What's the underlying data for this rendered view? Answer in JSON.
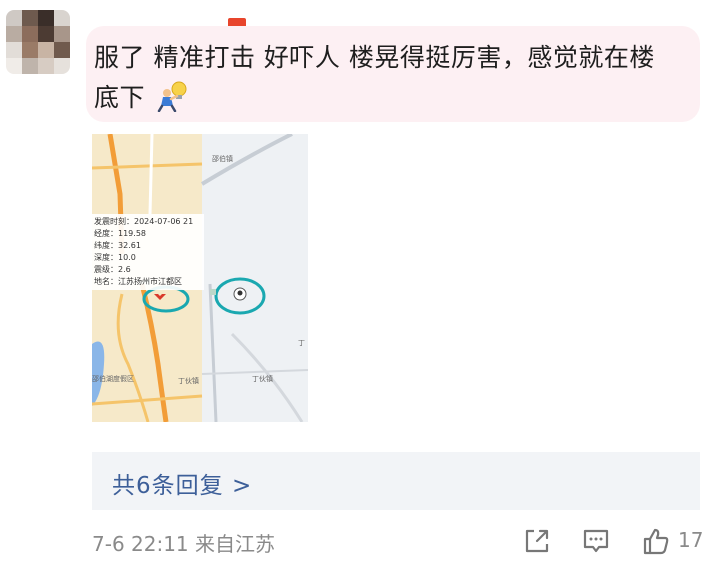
{
  "comment": {
    "text_line1": "服了 精准打击 好吓人 楼晃得挺厉害，感觉就在楼",
    "text_line2": "底下",
    "emoji": "walking-person-with-lightbulb-emoji"
  },
  "map": {
    "info": {
      "time_label": "发震时刻：",
      "time_value": "2024-07-06 21",
      "lon_label": "经度：",
      "lon_value": "119.58",
      "lat_label": "纬度：",
      "lat_value": "32.61",
      "depth_label": "深度：",
      "depth_value": "10.0",
      "mag_label": "震级：",
      "mag_value": "2.6",
      "place_label": "地名：",
      "place_value": "江苏扬州市江都区"
    },
    "labels": {
      "top": "邵伯镇",
      "right": "丁",
      "bottom_right": "丁伙镇",
      "bottom_mid": "丁伙镇",
      "left": "邵伯湖度假区"
    },
    "circle_color": "#1aa8b0"
  },
  "replies": {
    "link_text": "共6条回复 >"
  },
  "footer": {
    "meta": "7-6 22:11 来自江苏",
    "like_count": "17"
  },
  "icons": [
    "share-icon",
    "comment-icon",
    "thumbs-up-icon"
  ],
  "colors": {
    "bubble": "#fdf0f3",
    "reply_bar": "#f2f4f7",
    "link": "#3d5f99",
    "muted": "#8a8a8a"
  }
}
